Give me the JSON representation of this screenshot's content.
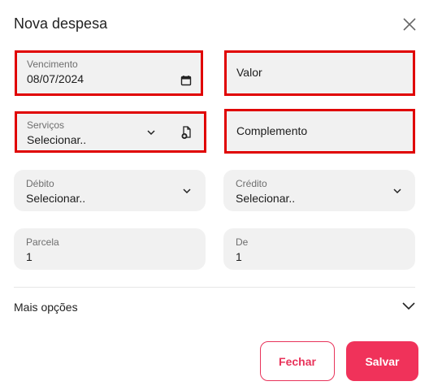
{
  "header": {
    "title": "Nova despesa",
    "close_icon": "close-icon"
  },
  "form": {
    "vencimento": {
      "label": "Vencimento",
      "value": "08/07/2024"
    },
    "valor": {
      "placeholder": "Valor"
    },
    "servicos": {
      "label": "Serviços",
      "value": "Selecionar.."
    },
    "complemento": {
      "placeholder": "Complemento"
    },
    "debito": {
      "label": "Débito",
      "value": "Selecionar.."
    },
    "credito": {
      "label": "Crédito",
      "value": "Selecionar.."
    },
    "parcela": {
      "label": "Parcela",
      "value": "1"
    },
    "de": {
      "label": "De",
      "value": "1"
    }
  },
  "more_options": {
    "label": "Mais opções"
  },
  "actions": {
    "close_label": "Fechar",
    "save_label": "Salvar"
  },
  "colors": {
    "highlight": "#e00000",
    "accent": "#f0325a",
    "field_bg": "#f1f1f1"
  }
}
